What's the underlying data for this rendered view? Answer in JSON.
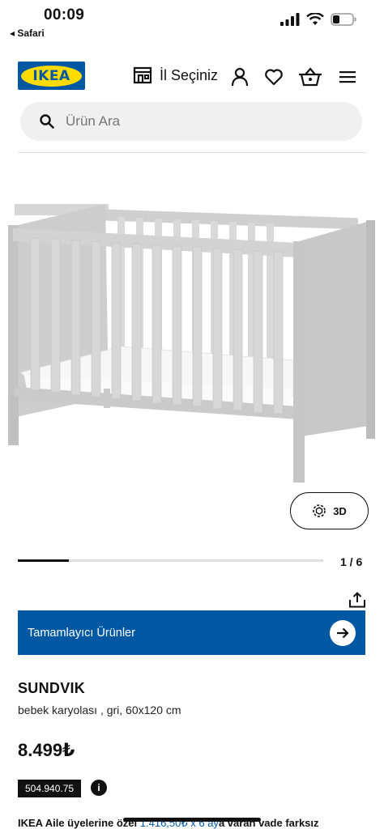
{
  "status_bar": {
    "time": "00:09",
    "back_app": "◂ Safari"
  },
  "header": {
    "logo_text": "IKEA",
    "store_label": "İl Seçiniz"
  },
  "search": {
    "placeholder": "Ürün Ara"
  },
  "gallery": {
    "view_3d_label": "3D",
    "pager": "1 / 6",
    "progress": 0.1667
  },
  "complementary": {
    "label": "Tamamlayıcı Ürünler"
  },
  "product": {
    "name": "SUNDVIK",
    "description": "bebek karyolası , gri, 60x120 cm",
    "price": "8.499₺",
    "article_number": "504.940.75",
    "info_label": "i"
  },
  "promo": {
    "prefix": "IKEA Aile üyelerine özel",
    "link": "1.416,50₺ x 6 ay",
    "suffix": "a varan vade farksız"
  },
  "colors": {
    "brand_blue": "#0058a3",
    "brand_yellow": "#ffdb00"
  }
}
